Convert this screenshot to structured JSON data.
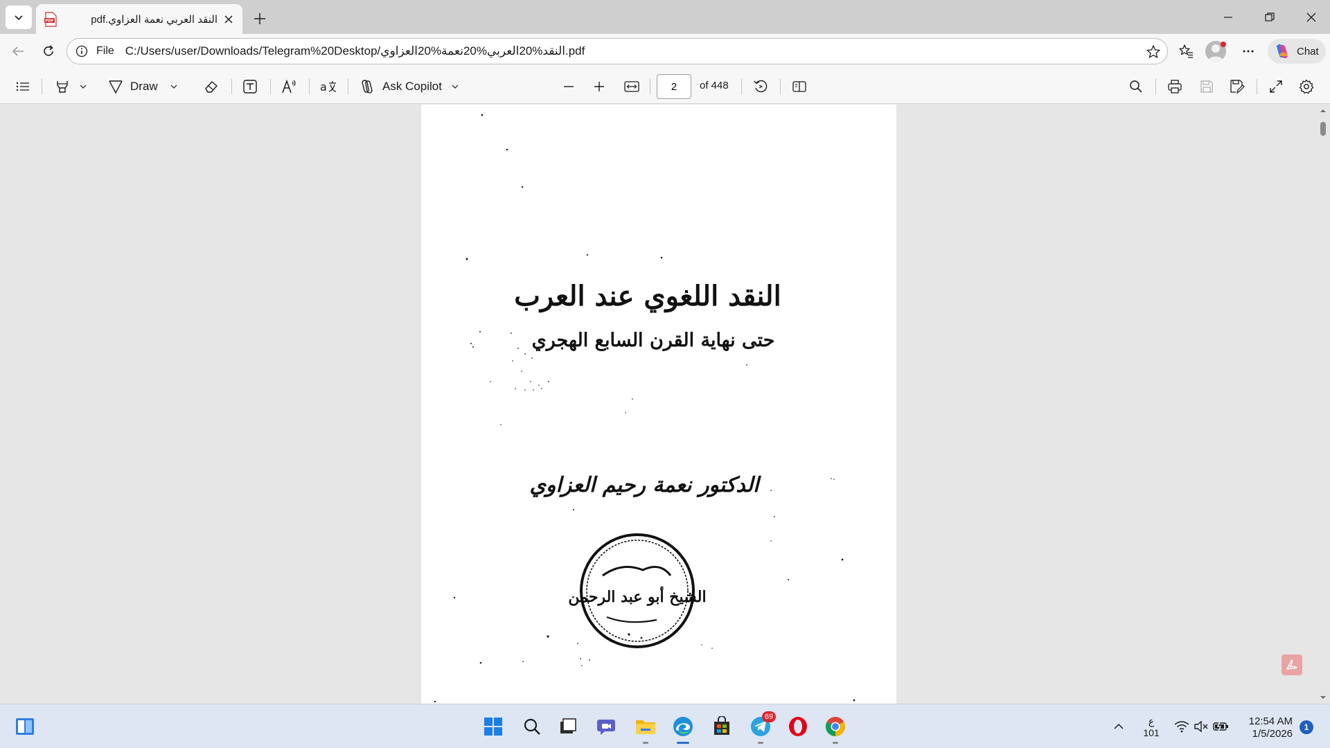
{
  "tab": {
    "title": "النقد العربي نعمة العزاوي.pdf"
  },
  "address_bar": {
    "scheme_label": "File",
    "url": "C:/Users/user/Downloads/Telegram%20Desktop/النقد%20العربي%20نعمة%20العزاوي.pdf"
  },
  "toolbar": {
    "draw_label": "Draw",
    "ask_copilot_label": "Ask Copilot",
    "page_current": "2",
    "page_total": "of 448"
  },
  "chat": {
    "label": "Chat"
  },
  "document": {
    "title_line1": "النقد اللغوي عند العرب",
    "title_line2": "حتى نهاية القرن السابع الهجري",
    "author": "الدكتور نعمة رحيم العزاوي",
    "stamp_text": "الشيخ أبو عبد الرحمن"
  },
  "taskbar": {
    "telegram_badge": "69",
    "lang_line1": "ع",
    "lang_line2": "101",
    "time": "12:54 AM",
    "date": "1/5/2026",
    "notification_count": "1"
  },
  "colors": {
    "tab_bar": "#cfcfcf",
    "toolbar": "#f7f7f7",
    "viewer_bg": "#e6e6e6",
    "taskbar": "#dde6f2",
    "accent": "#2b6fc9"
  },
  "icons": [
    "tab-actions-icon",
    "pdf-icon",
    "close-icon",
    "plus-icon",
    "minimize-icon",
    "maximize-icon",
    "close-window-icon",
    "back-icon",
    "refresh-icon",
    "info-icon",
    "favorite-star-icon",
    "favorites-icon",
    "profile-icon",
    "more-icon",
    "copilot-icon",
    "contents-icon",
    "highlight-icon",
    "draw-icon",
    "erase-icon",
    "text-box-icon",
    "read-aloud-icon",
    "translate-icon",
    "copilot-icon",
    "zoom-out-icon",
    "zoom-in-icon",
    "fit-width-icon",
    "rotate-icon",
    "page-view-icon",
    "search-icon",
    "print-icon",
    "save-icon",
    "save-as-icon",
    "fullscreen-icon",
    "settings-icon",
    "widgets-icon",
    "start-icon",
    "search-icon",
    "task-view-icon",
    "teams-icon",
    "file-explorer-icon",
    "edge-icon",
    "store-icon",
    "telegram-icon",
    "opera-icon",
    "chrome-icon",
    "chevron-up-icon",
    "wifi-icon",
    "speaker-muted-icon",
    "battery-icon"
  ]
}
